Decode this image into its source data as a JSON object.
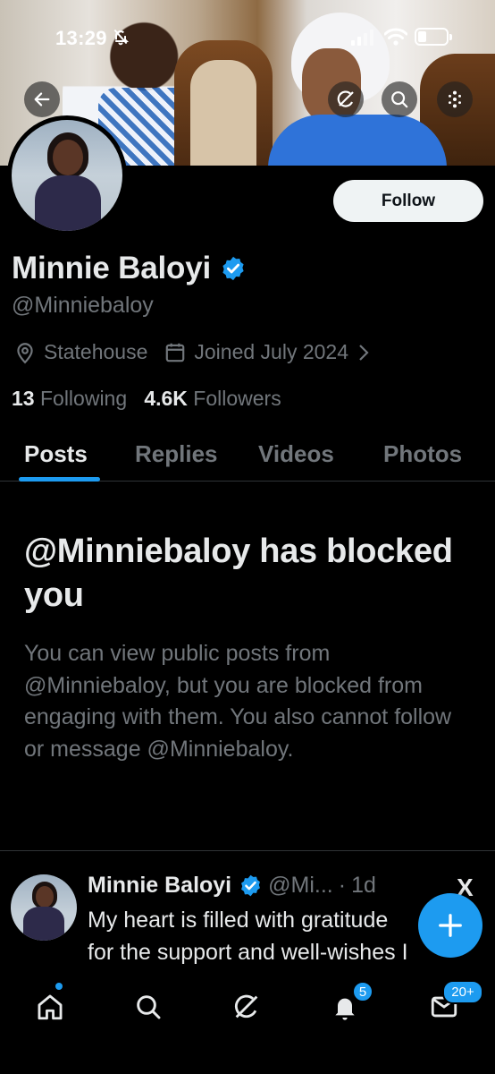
{
  "status_bar": {
    "time": "13:29",
    "icons": [
      "bell-off-icon",
      "cellular-signal-icon",
      "wifi-icon",
      "battery-icon"
    ]
  },
  "header": {
    "back_icon": "arrow-left-icon",
    "grok_icon": "grok-icon",
    "search_icon": "search-icon",
    "more_icon": "more-dots-icon"
  },
  "profile": {
    "name": "Minnie Baloyi",
    "handle": "@Minniebaloy",
    "location": "Statehouse",
    "joined": "Joined July 2024",
    "following_count": "13",
    "following_label": "Following",
    "followers_count": "4.6K",
    "followers_label": "Followers",
    "follow_button": "Follow"
  },
  "tabs": [
    {
      "label": "Posts",
      "active": true
    },
    {
      "label": "Replies",
      "active": false
    },
    {
      "label": "Videos",
      "active": false
    },
    {
      "label": "Photos",
      "active": false
    }
  ],
  "blocked_notice": {
    "title": "@Minniebaloy has blocked you",
    "description": "You can view public posts from @Minniebaloy, but you are blocked from engaging with them. You also cannot follow or message @Minniebaloy."
  },
  "post": {
    "author_name": "Minnie Baloyi",
    "author_handle": "@Mi...",
    "separator": "·",
    "time": "1d",
    "text_line1": "My heart is filled with gratitude",
    "text_line2": "for the support and well-wishes I",
    "source_logo": "X"
  },
  "fab": {
    "icon": "plus-icon"
  },
  "bottom_nav": {
    "items": [
      "home-icon",
      "search-icon",
      "grok-icon",
      "notifications-icon",
      "messages-icon"
    ],
    "notifications_badge": "5",
    "messages_badge": "20+"
  },
  "colors": {
    "accent": "#1d9bf0",
    "background": "#000000",
    "primary_text": "#e7e9ea",
    "secondary_text": "#71767b"
  }
}
